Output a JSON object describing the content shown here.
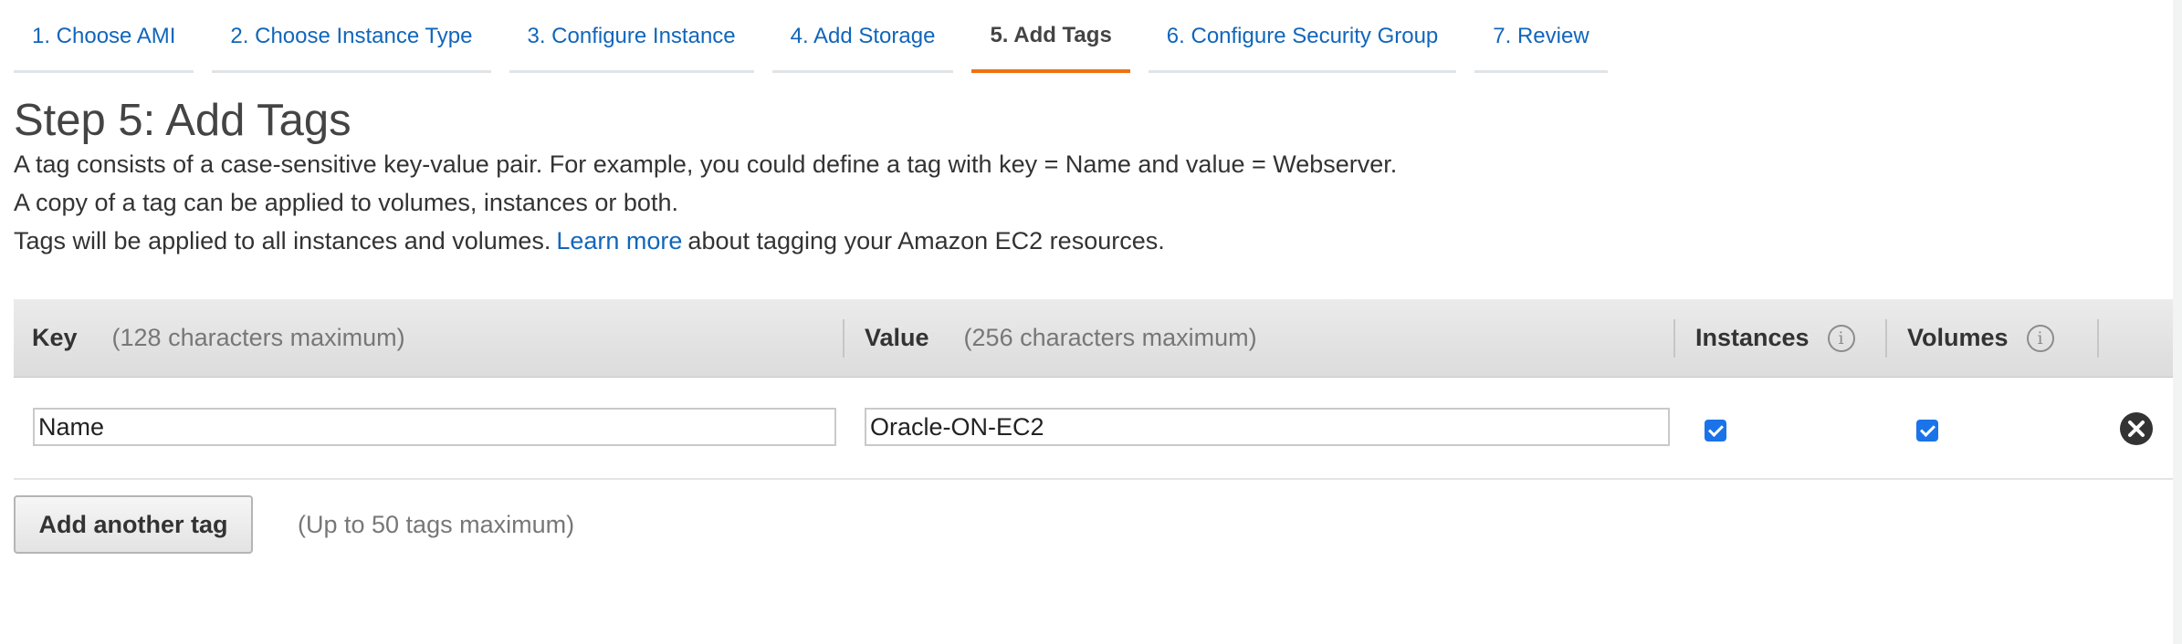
{
  "wizard": {
    "tabs": [
      {
        "label": "1. Choose AMI",
        "active": false
      },
      {
        "label": "2. Choose Instance Type",
        "active": false
      },
      {
        "label": "3. Configure Instance",
        "active": false
      },
      {
        "label": "4. Add Storage",
        "active": false
      },
      {
        "label": "5. Add Tags",
        "active": true
      },
      {
        "label": "6. Configure Security Group",
        "active": false
      },
      {
        "label": "7. Review",
        "active": false
      }
    ]
  },
  "page": {
    "title": "Step 5: Add Tags",
    "desc_line1": "A tag consists of a case-sensitive key-value pair. For example, you could define a tag with key = Name and value = Webserver.",
    "desc_line2": "A copy of a tag can be applied to volumes, instances or both.",
    "desc_line3_before": "Tags will be applied to all instances and volumes.",
    "learn_more": "Learn more",
    "desc_line3_after": "about tagging your Amazon EC2 resources."
  },
  "table": {
    "key_header": "Key",
    "key_hint": "(128 characters maximum)",
    "value_header": "Value",
    "value_hint": "(256 characters maximum)",
    "instances_header": "Instances",
    "volumes_header": "Volumes",
    "rows": [
      {
        "key": "Name",
        "value": "Oracle-ON-EC2",
        "instances": true,
        "volumes": true
      }
    ]
  },
  "actions": {
    "add_tag_label": "Add another tag",
    "limit_note": "(Up to 50 tags maximum)"
  },
  "icons": {
    "info": "info-icon",
    "remove": "close-circle-icon"
  },
  "colors": {
    "link": "#1166bb",
    "active_tab_underline": "#ec7211",
    "checkbox": "#1a73e8"
  }
}
